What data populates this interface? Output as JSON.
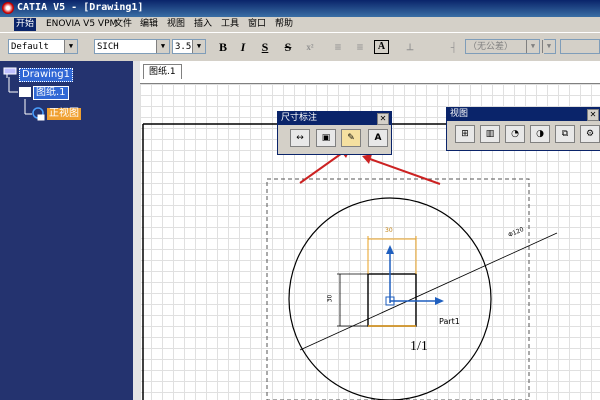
{
  "window": {
    "title": "CATIA V5 - [Drawing1]"
  },
  "menu": [
    "开始",
    "ENOVIA V5 VPM",
    "文件",
    "编辑",
    "视图",
    "插入",
    "工具",
    "窗口",
    "帮助"
  ],
  "toolbar": {
    "style_value": "Default",
    "font_value": "SICH",
    "size_value": "3.5",
    "bold": "B",
    "italic": "I",
    "underline": "S",
    "strike": "S",
    "frame": "A",
    "tolerance_value": "（无公差）"
  },
  "tree": {
    "root": "Drawing1",
    "sheet": "图纸.1",
    "view": "正视图"
  },
  "canvas": {
    "tab": "图纸.1",
    "dim_width": "30",
    "dim_height": "30",
    "dim_dia": "Φ120",
    "part_label": "Part1",
    "scale": "1/1"
  },
  "dim_toolbar": {
    "title": "尺寸标注",
    "text_icon": "A"
  },
  "view_toolbar": {
    "title": "视图"
  },
  "colors": {
    "title_bar": "#0a246a",
    "tree_bg": "#24336f",
    "highlight": "#f0a030",
    "arrow": "#cc2222",
    "axis": "#1f5fbf"
  }
}
